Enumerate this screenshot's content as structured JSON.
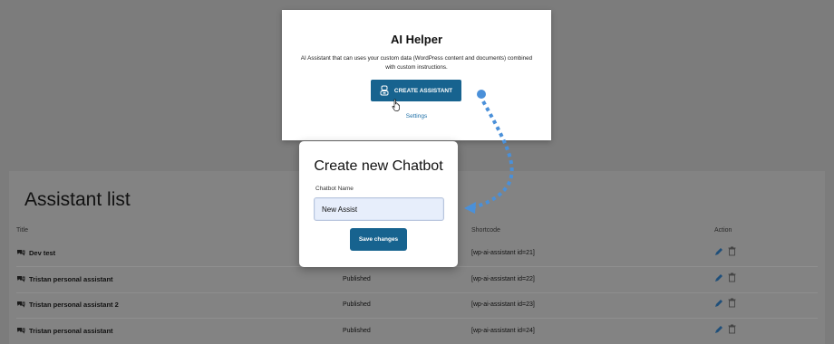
{
  "helper": {
    "title": "AI Helper",
    "description": "AI Assistant that can uses your custom data (WordPress content and documents) combined with custom instructions.",
    "create_button": "CREATE ASSISTANT",
    "settings_link": "Settings"
  },
  "modal": {
    "title": "Create new Chatbot",
    "field_label": "Chatbot Name",
    "field_value": "New Assist",
    "save_button": "Save changes"
  },
  "list": {
    "title": "Assistant list",
    "columns": {
      "title": "Title",
      "shortcode": "Shortcode",
      "action": "Action"
    },
    "rows": [
      {
        "title": "Dev test",
        "status": "",
        "shortcode": "[wp-ai-assistant id=21]"
      },
      {
        "title": "Tristan personal assistant",
        "status": "Published",
        "shortcode": "[wp-ai-assistant id=22]"
      },
      {
        "title": "Tristan personal assistant 2",
        "status": "Published",
        "shortcode": "[wp-ai-assistant id=23]"
      },
      {
        "title": "Tristan personal assistant",
        "status": "Published",
        "shortcode": "[wp-ai-assistant id=24]"
      }
    ]
  },
  "icons": {
    "row_icon": "chat-bubbles-icon",
    "edit": "pencil-icon",
    "delete": "trash-icon",
    "button_icon": "robot-icon"
  },
  "colors": {
    "overlay": "#7c7c7c",
    "primary": "#17638f",
    "link": "#1f70a8",
    "arrow": "#4a90d9"
  }
}
